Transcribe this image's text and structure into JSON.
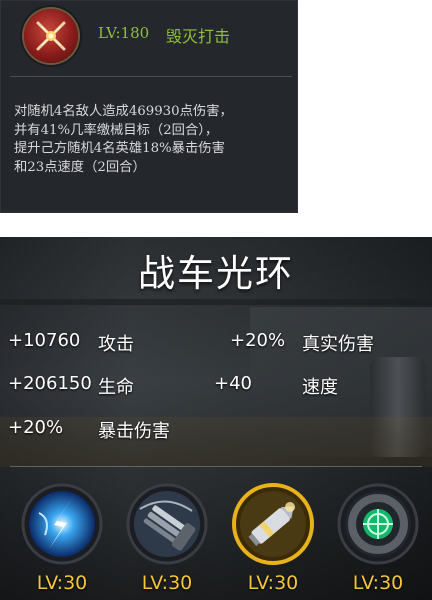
{
  "tooltip": {
    "skill_icon": "crossed-weapons-icon",
    "level": "LV:180",
    "name": "毁灭打击",
    "description_lines": [
      "对随机4名敌人造成469930点伤害，",
      "并有41%几率缴械目标（2回合），",
      "提升己方随机4名英雄18%暴击伤害",
      "和23点速度（2回合）"
    ]
  },
  "aura": {
    "title": "战车光环",
    "stats": {
      "attack_value": "+10760",
      "attack_label": "攻击",
      "true_damage_value": "+20%",
      "true_damage_label": "真实伤害",
      "hp_value": "+206150",
      "hp_label": "生命",
      "speed_value": "+40",
      "speed_label": "速度",
      "crit_value": "+20%",
      "crit_label": "暴击伤害"
    },
    "skills": [
      {
        "icon": "lightning-strike-icon",
        "level": "LV:30"
      },
      {
        "icon": "gatling-gun-icon",
        "level": "LV:30"
      },
      {
        "icon": "cannon-shell-icon",
        "level": "LV:30"
      },
      {
        "icon": "crosshair-tire-icon",
        "level": "LV:30"
      }
    ]
  },
  "colors": {
    "level_green": "#8fbf3a",
    "level_gold": "#f5c53a",
    "tooltip_bg": "#24272c"
  }
}
